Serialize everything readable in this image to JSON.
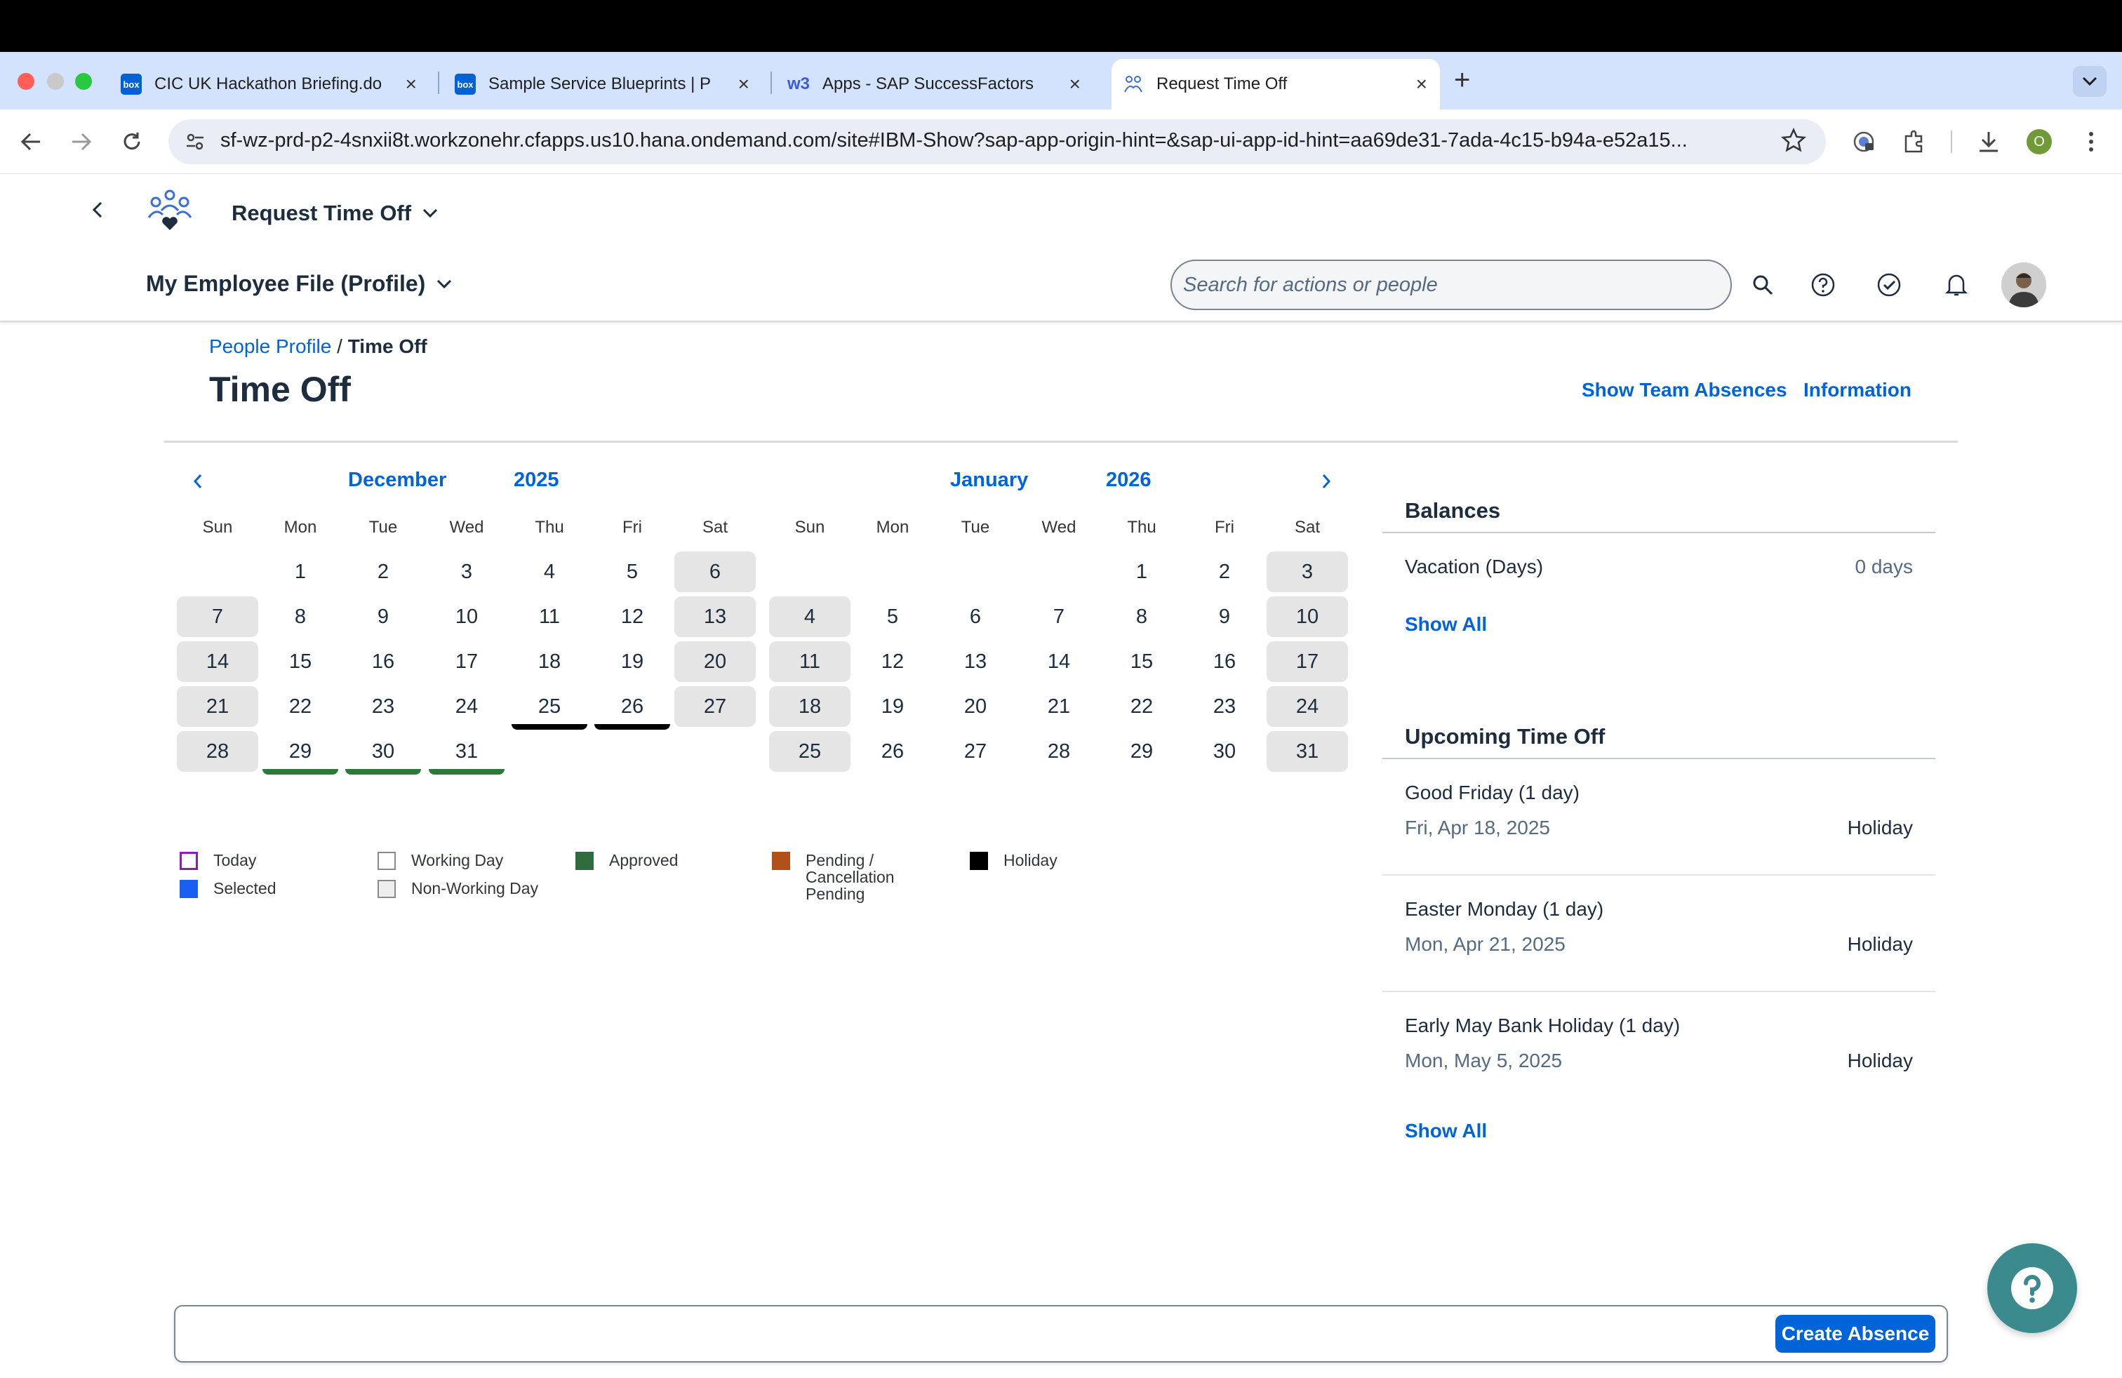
{
  "browser": {
    "tabs": [
      {
        "title": "CIC UK Hackathon Briefing.do",
        "favicon": "box"
      },
      {
        "title": "Sample Service Blueprints | P",
        "favicon": "box"
      },
      {
        "title": "Apps - SAP SuccessFactors",
        "favicon": "w3"
      },
      {
        "title": "Request Time Off",
        "favicon": "sap"
      }
    ],
    "favicon_box_text": "box",
    "favicon_w3_text": "w3",
    "url": "sf-wz-prd-p2-4snxii8t.workzonehr.cfapps.us10.hana.ondemand.com/site#IBM-Show?sap-app-origin-hint=&sap-ui-app-id-hint=aa69de31-7ada-4c15-b94a-e52a15...",
    "profile_initial": "O"
  },
  "shell": {
    "app_title": "Request Time Off",
    "profile_title": "My Employee File (Profile)",
    "search_placeholder": "Search for actions or people"
  },
  "page": {
    "breadcrumb_link": "People Profile",
    "breadcrumb_sep": "/",
    "breadcrumb_current": "Time Off",
    "title": "Time Off",
    "show_team_absences": "Show Team Absences",
    "information": "Information"
  },
  "calendar": {
    "weekdays": [
      "Sun",
      "Mon",
      "Tue",
      "Wed",
      "Thu",
      "Fri",
      "Sat"
    ],
    "months": [
      {
        "month": "December",
        "year": "2025",
        "first_weekday": 1,
        "days": 31,
        "holidays": [
          25,
          26
        ],
        "approved": [
          29,
          30,
          31
        ]
      },
      {
        "month": "January",
        "year": "2026",
        "first_weekday": 4,
        "days": 31,
        "holidays": [],
        "approved": []
      }
    ]
  },
  "legend": [
    {
      "label": "Today",
      "style": "outline",
      "color": "#8b1fb5"
    },
    {
      "label": "Selected",
      "style": "fill",
      "color": "#1b5ef2"
    },
    {
      "label": "Working Day",
      "style": "outline",
      "color": "#8a8a8a"
    },
    {
      "label": "Non-Working Day",
      "style": "outline-fill",
      "color": "#8a8a8a"
    },
    {
      "label": "Approved",
      "style": "fill",
      "color": "#2f6b3d"
    },
    {
      "label": "Pending /\nCancellation\nPending",
      "style": "fill",
      "color": "#b2501a"
    },
    {
      "label": "Holiday",
      "style": "fill",
      "color": "#000000"
    }
  ],
  "balances": {
    "title": "Balances",
    "items": [
      {
        "label": "Vacation (Days)",
        "value": "0 days"
      }
    ],
    "show_all": "Show All"
  },
  "upcoming": {
    "title": "Upcoming Time Off",
    "items": [
      {
        "name": "Good Friday (1 day)",
        "date": "Fri, Apr 18, 2025",
        "type": "Holiday"
      },
      {
        "name": "Easter Monday (1 day)",
        "date": "Mon, Apr 21, 2025",
        "type": "Holiday"
      },
      {
        "name": "Early May Bank Holiday (1 day)",
        "date": "Mon, May 5, 2025",
        "type": "Holiday"
      }
    ],
    "show_all": "Show All"
  },
  "footer": {
    "create_absence": "Create Absence"
  },
  "colors": {
    "link": "#0064d9",
    "approved": "#2b7a38",
    "holiday": "#000000",
    "weekend_bg": "#e5e5e5",
    "help_fab": "#3a8a8e"
  },
  "icons": {
    "help": "question-icon",
    "search": "search-icon",
    "bell": "bell-icon",
    "todo": "check-circle-icon"
  }
}
